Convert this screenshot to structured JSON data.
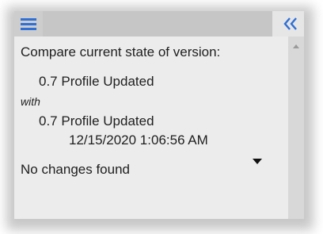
{
  "header": {
    "menu_icon": "hamburger-menu-icon",
    "collapse_icon": "double-chevron-left-icon",
    "accent_color": "#2f6fd6"
  },
  "compare": {
    "prompt": "Compare current state of version:",
    "current_version": "0.7 Profile Updated",
    "connector": "with",
    "other_version": "0.7 Profile Updated",
    "other_version_date": "12/15/2020 1:06:56 AM",
    "dropdown_icon": "caret-down-icon",
    "result": "No changes found"
  }
}
